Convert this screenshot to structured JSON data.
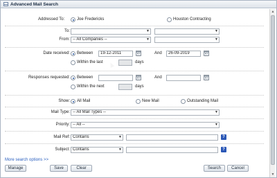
{
  "window": {
    "title": "Advanced Mail Search"
  },
  "addressed_to": {
    "label": "Addressed To:",
    "option1": "Joe Fredericks",
    "option2": "Houston Contracting"
  },
  "to": {
    "label": "To:"
  },
  "from": {
    "label": "From:",
    "company_select": "-- All Companies --"
  },
  "date_received": {
    "label": "Date received:",
    "between": "Between",
    "start": "19-12-2011",
    "and": "And",
    "end": "26-09-2019",
    "within_last": "Within the last",
    "days": "days"
  },
  "responses_requested": {
    "label": "Responses requested:",
    "between": "Between",
    "and": "And",
    "within_next": "Within the next",
    "days": "days"
  },
  "show": {
    "label": "Show:",
    "all_mail": "All Mail",
    "new_mail": "New Mail",
    "outstanding_mail": "Outstanding Mail"
  },
  "mail_type": {
    "label": "Mail Type:",
    "value": "-- All Mail Types --"
  },
  "priority": {
    "label": "Priority:",
    "value": "-- All --"
  },
  "mail_ref": {
    "label": "Mail Ref:",
    "mode": "Contains",
    "help": "?"
  },
  "subject": {
    "label": "Subject:",
    "mode": "Contains",
    "help": "?"
  },
  "more_options": "More search options >>",
  "buttons": {
    "manage": "Manage",
    "save": "Save",
    "clear": "Clear",
    "search": "Search",
    "cancel": "Cancel"
  },
  "icons": {
    "title": "mail-search-icon",
    "calendar": "calendar-icon",
    "help": "help-icon",
    "dropdown": "chevron-down-icon"
  }
}
